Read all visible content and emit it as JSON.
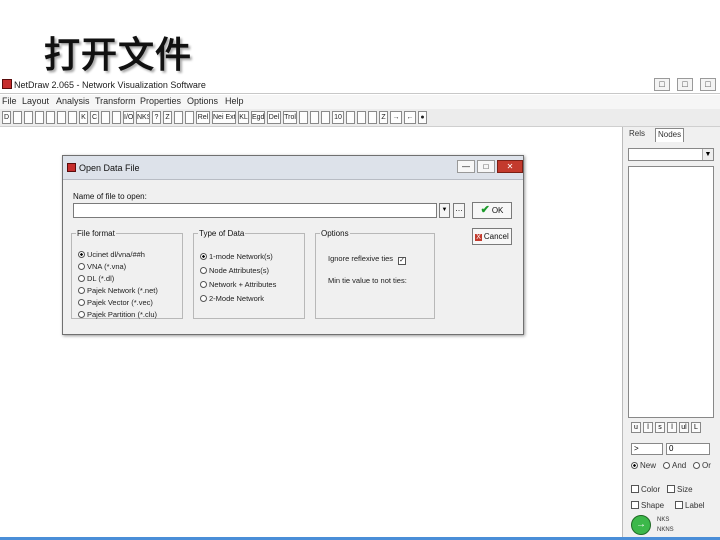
{
  "slide": {
    "title": "打开文件"
  },
  "app": {
    "title": "NetDraw 2.065 - Network Visualization Software",
    "window_buttons": [
      "□",
      "□",
      "□"
    ],
    "menu": [
      "File",
      "Layout",
      "Analysis",
      "Transform",
      "Properties",
      "Options",
      "Help"
    ],
    "toolbar": [
      "D",
      "",
      "",
      "",
      "",
      "",
      "",
      "K",
      "C",
      "",
      "",
      "I/O",
      "NKS",
      "?",
      "Z",
      "",
      "",
      "Rel",
      "Nei Ext",
      "KL",
      "Egd",
      "Del",
      "Trol",
      "",
      "",
      "",
      "10",
      "",
      "",
      "",
      "Z",
      "→",
      "←",
      "●"
    ]
  },
  "right_panel": {
    "tabs": [
      "Rels",
      "Nodes"
    ],
    "small_buttons": [
      "u",
      "l",
      "s",
      "l",
      "ul",
      "L"
    ],
    "operator": ">",
    "value": "0",
    "radios": [
      "New",
      "And",
      "Or"
    ],
    "checks": [
      "Color",
      "Size",
      "Shape",
      "Label"
    ],
    "hints": [
      "NKS",
      "NKNS"
    ],
    "go_glyph": "→"
  },
  "dialog": {
    "title": "Open Data File",
    "buttons": [
      "—",
      "□",
      "✕"
    ],
    "file_label": "Name of file to open:",
    "file_value": "",
    "browse_glyph": "…",
    "dropdown_glyph": "▼",
    "ok_label": "OK",
    "ok_glyph": "✔",
    "cancel_label": "Cancel",
    "cancel_glyph": "X",
    "format_group": {
      "legend": "File format",
      "options": [
        "Ucinet dl/vna/##h",
        "VNA (*.vna)",
        "DL (*.dl)",
        "Pajek Network (*.net)",
        "Pajek Vector (*.vec)",
        "Pajek Partition (*.clu)"
      ],
      "selected": 0
    },
    "type_group": {
      "legend": "Type of Data",
      "options": [
        "1-mode Network(s)",
        "Node Attributes(s)",
        "Network + Attributes",
        "2-Mode Network"
      ],
      "selected": 0
    },
    "options_group": {
      "legend": "Options",
      "ignore_label": "Ignore reflexive ties",
      "ignore_checked": "✓",
      "min_label": "Min tie value to not ties:"
    }
  }
}
